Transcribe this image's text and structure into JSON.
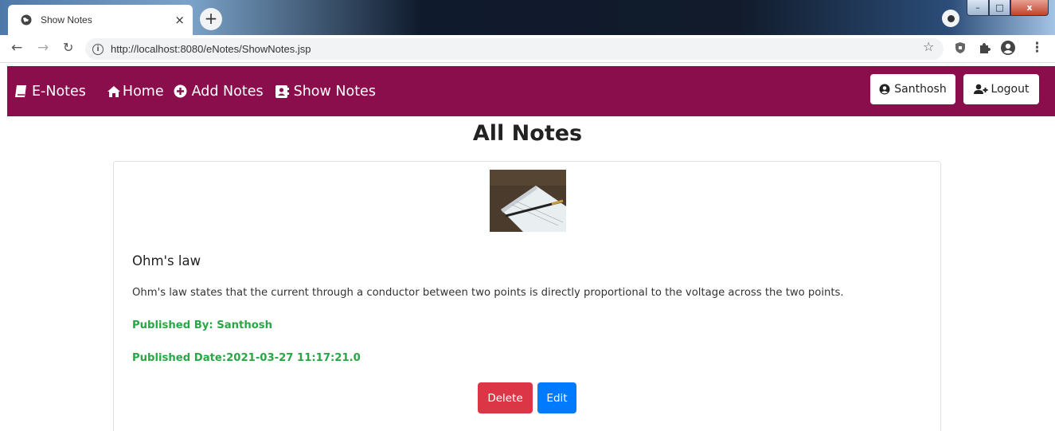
{
  "browser": {
    "tab_title": "Show Notes",
    "tab_close": "×",
    "new_tab": "+",
    "url": "http://localhost:8080/eNotes/ShowNotes.jsp",
    "window_controls": {
      "minimize": "–",
      "maximize": "□",
      "close": "x"
    }
  },
  "navbar": {
    "background": "#8a0e4c",
    "brand": "E-Notes",
    "links": [
      {
        "label": "Home",
        "icon": "home-icon"
      },
      {
        "label": "Add Notes",
        "icon": "plus-circle-icon"
      },
      {
        "label": "Show Notes",
        "icon": "address-book-icon"
      }
    ],
    "user_button": {
      "label": "Santhosh",
      "icon": "user-circle-icon"
    },
    "logout_button": {
      "label": "Logout",
      "icon": "user-plus-icon"
    }
  },
  "page": {
    "title": "All Notes"
  },
  "note": {
    "title": "Ohm's law",
    "content": "Ohm's law states that the current through a conductor between two points is directly proportional to the voltage across the two points.",
    "published_by": "Published By: Santhosh",
    "published_date": "Published Date:2021-03-27 11:17:21.0",
    "delete_label": "Delete",
    "edit_label": "Edit"
  },
  "colors": {
    "accent": "#8a0e4c",
    "success_text": "#28a745",
    "danger": "#dc3545",
    "primary": "#007bff"
  }
}
